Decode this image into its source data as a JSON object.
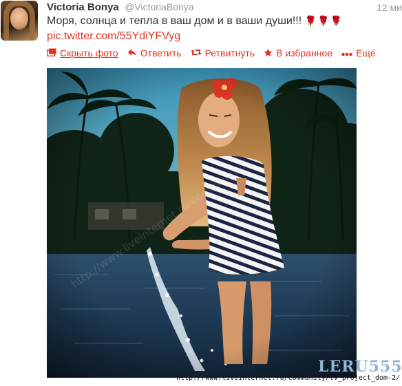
{
  "tweet": {
    "author_name": "Victoria Bonya",
    "handle": "@VictoriaBonya",
    "time": "12 ми",
    "text": "Моря, солнца и тепла в ваш дом и в ваши души!!!",
    "text_emoji": "🌹🌹🌹",
    "link": "pic.twitter.com/55YdiYFVyg"
  },
  "actions": [
    {
      "label": "Скрыть фото",
      "icon": "photo-icon"
    },
    {
      "label": "Ответить",
      "icon": "reply-icon"
    },
    {
      "label": "Ретвитнуть",
      "icon": "retweet-icon"
    },
    {
      "label": "В избранное",
      "icon": "star-icon"
    },
    {
      "label": "Ещё",
      "icon": "more-icon"
    }
  ],
  "watermark": {
    "brand": "LERU555",
    "url": "http://www.liveinternet.ru/community/tv_project_dom-2/"
  },
  "colors": {
    "accent": "#e0331f",
    "name": "#333333",
    "muted": "#999999",
    "watermark": "#8fb6d8"
  }
}
